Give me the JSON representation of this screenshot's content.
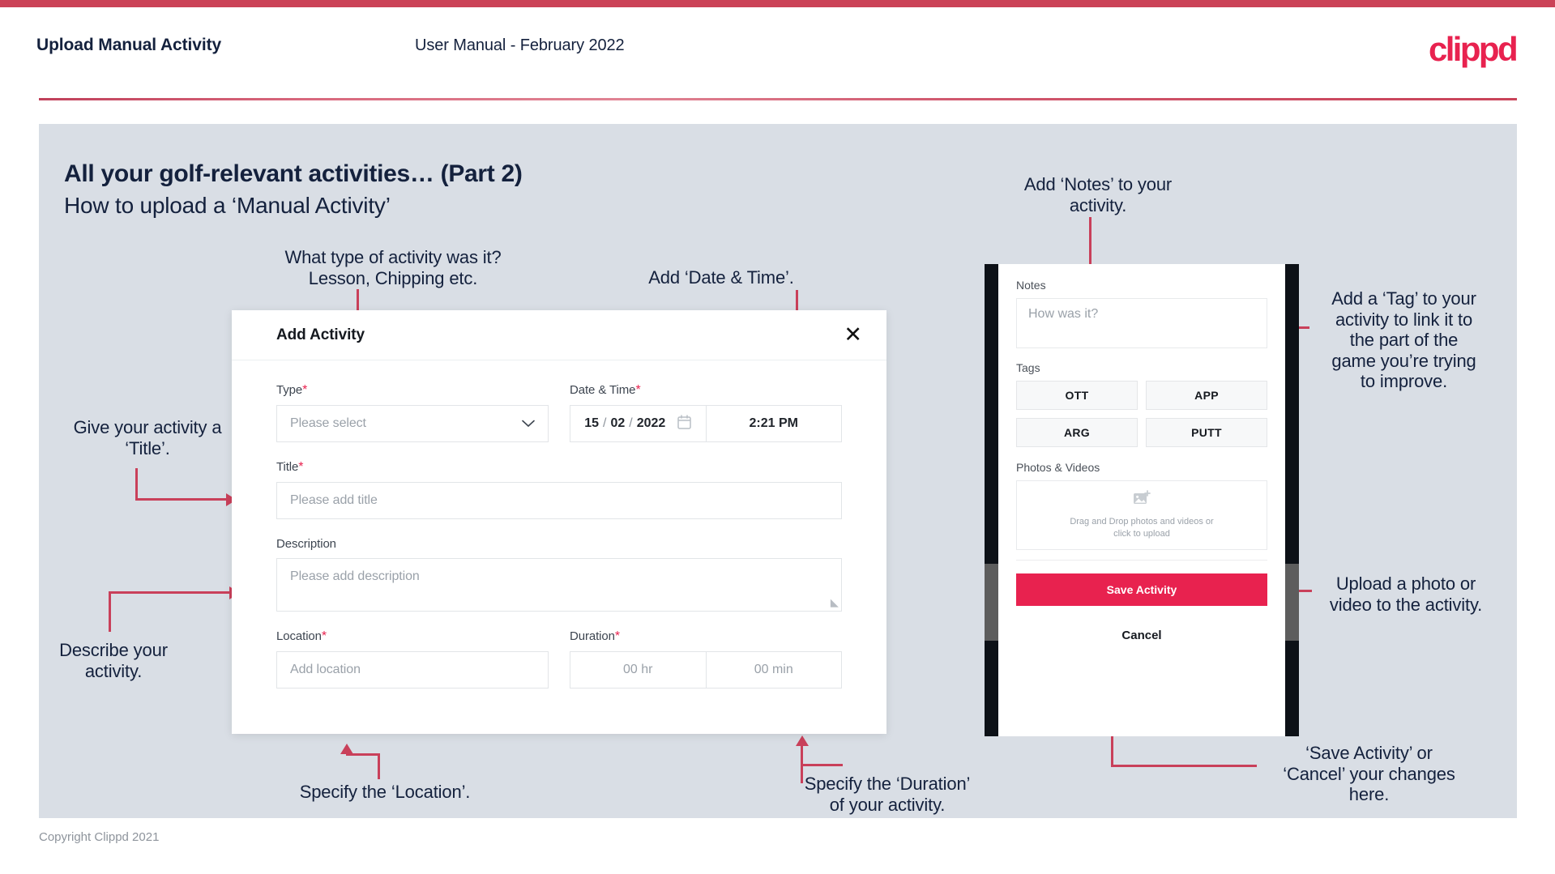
{
  "header": {
    "title": "Upload Manual Activity",
    "subtitle": "User Manual - February 2022",
    "logo": "clippd"
  },
  "slide": {
    "title": "All your golf-relevant activities… (Part 2)",
    "subtitle": "How to upload a ‘Manual Activity’"
  },
  "annotations": {
    "type": "What type of activity was it?\nLesson, Chipping etc.",
    "datetime": "Add ‘Date & Time’.",
    "title_field": "Give your activity a\n‘Title’.",
    "description": "Describe your\nactivity.",
    "location": "Specify the ‘Location’.",
    "duration": "Specify the ‘Duration’\nof your activity.",
    "notes": "Add ‘Notes’ to your\nactivity.",
    "tags": "Add a ‘Tag’ to your\nactivity to link it to\nthe part of the\ngame you’re trying\nto improve.",
    "upload": "Upload a photo or\nvideo to the activity.",
    "save": "‘Save Activity’ or\n‘Cancel’ your changes\nhere."
  },
  "modal": {
    "title": "Add Activity",
    "close_icon": "close-icon",
    "fields": {
      "type": {
        "label": "Type",
        "required": "*",
        "placeholder": "Please select",
        "chevron": "chevron-down-icon"
      },
      "datetime": {
        "label": "Date & Time",
        "required": "*",
        "day": "15",
        "month": "02",
        "year": "2022",
        "sep": "/",
        "calendar_icon": "calendar-icon",
        "time": "2:21 PM"
      },
      "title": {
        "label": "Title",
        "required": "*",
        "placeholder": "Please add title"
      },
      "description": {
        "label": "Description",
        "required": "",
        "placeholder": "Please add description"
      },
      "location": {
        "label": "Location",
        "required": "*",
        "placeholder": "Add location"
      },
      "duration": {
        "label": "Duration",
        "required": "*",
        "hours_placeholder": "00 hr",
        "minutes_placeholder": "00 min"
      }
    }
  },
  "phone": {
    "notes": {
      "label": "Notes",
      "placeholder": "How was it?"
    },
    "tags": {
      "label": "Tags",
      "items": [
        "OTT",
        "APP",
        "ARG",
        "PUTT"
      ]
    },
    "photos": {
      "label": "Photos & Videos",
      "icon": "add-image-icon",
      "drop_text": "Drag and Drop photos and videos or click to upload"
    },
    "save_label": "Save Activity",
    "cancel_label": "Cancel"
  },
  "footer": {
    "copyright": "Copyright Clippd 2021"
  },
  "colors": {
    "brand_pink": "#e8224f",
    "accent_line": "#c9405a",
    "slide_bg": "#d9dee5",
    "text_navy": "#14213d"
  }
}
